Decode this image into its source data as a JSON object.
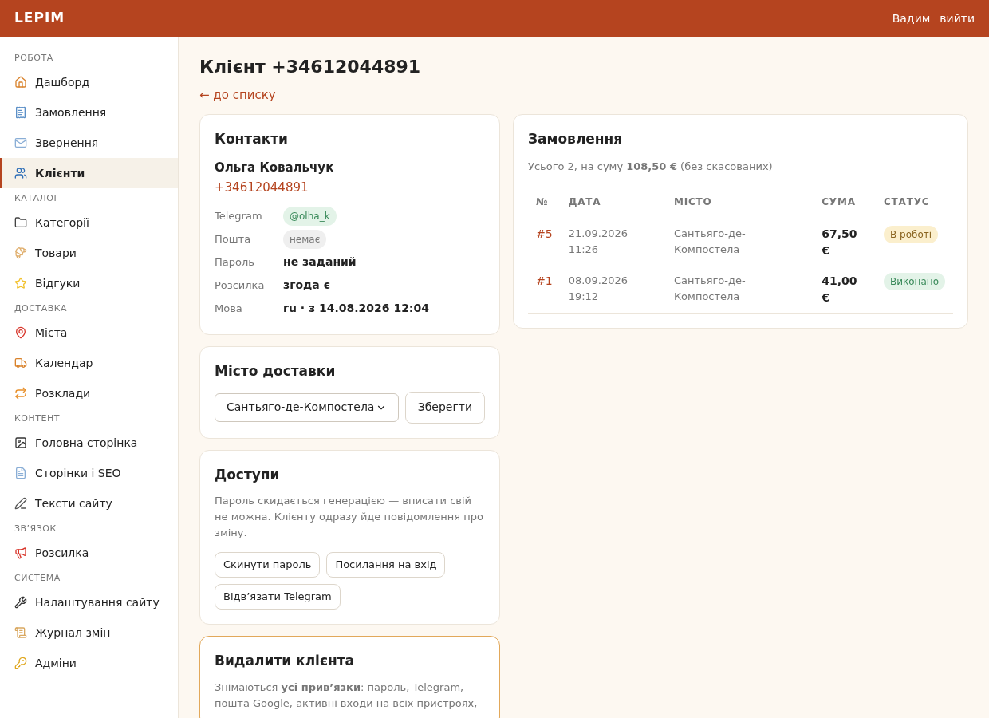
{
  "header": {
    "logo": "LEPIM",
    "user": "Вадим",
    "logout": "вийти"
  },
  "sidebar": {
    "sections": [
      {
        "title": "РОБОТА",
        "items": [
          {
            "label": "Дашборд",
            "selected": false
          },
          {
            "label": "Замовлення",
            "selected": false
          },
          {
            "label": "Звернення",
            "selected": false
          },
          {
            "label": "Клієнти",
            "selected": true
          }
        ]
      },
      {
        "title": "КАТАЛОГ",
        "items": [
          {
            "label": "Категорії",
            "selected": false
          },
          {
            "label": "Товари",
            "selected": false
          },
          {
            "label": "Відгуки",
            "selected": false
          }
        ]
      },
      {
        "title": "ДОСТАВКА",
        "items": [
          {
            "label": "Міста",
            "selected": false
          },
          {
            "label": "Календар",
            "selected": false
          },
          {
            "label": "Розклади",
            "selected": false
          }
        ]
      },
      {
        "title": "КОНТЕНТ",
        "items": [
          {
            "label": "Головна сторінка",
            "selected": false
          },
          {
            "label": "Сторінки і SEO",
            "selected": false
          },
          {
            "label": "Тексти сайту",
            "selected": false
          }
        ]
      },
      {
        "title": "ЗВ’ЯЗОК",
        "items": [
          {
            "label": "Розсилка",
            "selected": false
          }
        ]
      },
      {
        "title": "СИСТЕМА",
        "items": [
          {
            "label": "Налаштування сайту",
            "selected": false
          },
          {
            "label": "Журнал змін",
            "selected": false
          },
          {
            "label": "Адміни",
            "selected": false
          }
        ]
      }
    ]
  },
  "page": {
    "title": "Клієнт +34612044891",
    "back_link": "← до списку"
  },
  "contacts": {
    "title": "Контакти",
    "name": "Ольга Ковальчук",
    "phone": "+34612044891",
    "fields": [
      {
        "label": "Telegram",
        "value": "@olha_k",
        "kind": "chip_ok"
      },
      {
        "label": "Пошта",
        "value": "немає",
        "kind": "chip_none"
      },
      {
        "label": "Пароль",
        "value": "не заданий",
        "kind": "text"
      },
      {
        "label": "Розсилка",
        "value": "згода є",
        "kind": "text"
      },
      {
        "label": "Мова",
        "value": "ru · з 14.08.2026 12:04",
        "kind": "text"
      }
    ]
  },
  "delivery_city": {
    "title": "Місто доставки",
    "value": "Сантьяго-де-Компостела",
    "save": "Зберегти"
  },
  "access": {
    "title": "Доступи",
    "text": "Пароль скидається генерацією — вписати свій не можна. Клієнту одразу йде повідомлення про зміну.",
    "buttons": [
      "Скинути пароль",
      "Посилання на вхід",
      "Відв’язати Telegram"
    ]
  },
  "delete": {
    "title": "Видалити клієнта",
    "text": "Знімаються **усі прив’язки**: пароль, Telegram, пошта Google, активні входи на всіх пристроях,"
  },
  "orders": {
    "title": "Замовлення",
    "summary": "Усього 2, на суму **108,50 €** (без скасованих)",
    "columns": [
      "№",
      "ДАТА",
      "МІСТО",
      "СУМА",
      "СТАТУС"
    ],
    "rows": [
      {
        "number": "#5",
        "date": "21.09.2026 11:26",
        "city": "Сантьяго-де-Компостела",
        "sum": "67,50 €",
        "status": "В роботі",
        "kind": "in_progress"
      },
      {
        "number": "#1",
        "date": "08.09.2026 19:12",
        "city": "Сантьяго-де-Компостела",
        "sum": "41,00 €",
        "status": "Виконано",
        "kind": "done"
      }
    ]
  }
}
